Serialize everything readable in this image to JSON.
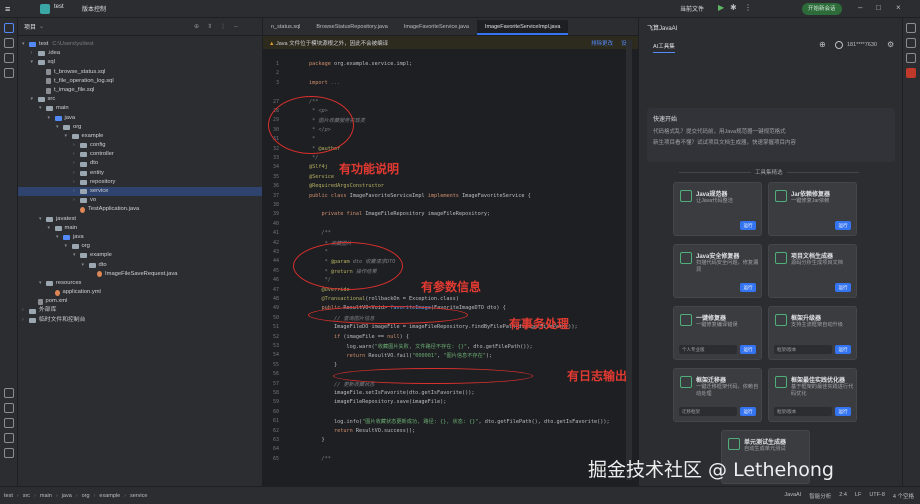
{
  "titlebar": {
    "project_name": "test",
    "branch": "版本控制",
    "run_config": "当前文件",
    "run_button": "开始新会话"
  },
  "project": {
    "title": "项目",
    "rows": [
      {
        "d": 0,
        "t": "test",
        "x": "C:\\Users\\yu\\test",
        "k": "fb",
        "a": "▾"
      },
      {
        "d": 1,
        "t": ".idea",
        "k": "f",
        "a": "›"
      },
      {
        "d": 1,
        "t": "sql",
        "k": "f",
        "a": "▾"
      },
      {
        "d": 2,
        "t": "t_browse_status.sql",
        "k": "file"
      },
      {
        "d": 2,
        "t": "t_file_operation_log.sql",
        "k": "file"
      },
      {
        "d": 2,
        "t": "t_image_file.sql",
        "k": "file"
      },
      {
        "d": 1,
        "t": "src",
        "k": "f",
        "a": "▾"
      },
      {
        "d": 2,
        "t": "main",
        "k": "f",
        "a": "▾"
      },
      {
        "d": 3,
        "t": "java",
        "k": "fb",
        "a": "▾"
      },
      {
        "d": 4,
        "t": "org",
        "k": "f",
        "a": "▾"
      },
      {
        "d": 5,
        "t": "example",
        "k": "f",
        "a": "▾"
      },
      {
        "d": 6,
        "t": "config",
        "k": "f",
        "a": "›"
      },
      {
        "d": 6,
        "t": "controller",
        "k": "f",
        "a": "›"
      },
      {
        "d": 6,
        "t": "dto",
        "k": "f",
        "a": "›"
      },
      {
        "d": 6,
        "t": "entity",
        "k": "f",
        "a": "›"
      },
      {
        "d": 6,
        "t": "repository",
        "k": "f",
        "a": "›"
      },
      {
        "d": 6,
        "t": "service",
        "k": "f",
        "a": "›",
        "sel": true
      },
      {
        "d": 6,
        "t": "vo",
        "k": "f",
        "a": "›"
      },
      {
        "d": 6,
        "t": "TestApplication.java",
        "k": "j"
      },
      {
        "d": 2,
        "t": "javatest",
        "k": "f",
        "a": "▾"
      },
      {
        "d": 3,
        "t": "main",
        "k": "f",
        "a": "▾"
      },
      {
        "d": 4,
        "t": "java",
        "k": "fb",
        "a": "▾"
      },
      {
        "d": 5,
        "t": "org",
        "k": "f",
        "a": "▾"
      },
      {
        "d": 6,
        "t": "example",
        "k": "f",
        "a": "▾"
      },
      {
        "d": 7,
        "t": "dto",
        "k": "f",
        "a": "▾"
      },
      {
        "d": 8,
        "t": "ImageFileSaveRequest.java",
        "k": "j"
      },
      {
        "d": 2,
        "t": "resources",
        "k": "f",
        "a": "▾"
      },
      {
        "d": 3,
        "t": "application.yml",
        "k": "j"
      },
      {
        "d": 1,
        "t": "pom.xml",
        "k": "file"
      },
      {
        "d": 0,
        "t": "外部库",
        "k": "f",
        "a": "›"
      },
      {
        "d": 0,
        "t": "临时文件和控制台",
        "k": "f",
        "a": "›"
      }
    ]
  },
  "editor": {
    "tabs": [
      "n_status.sql",
      "BrowseStatusRepository.java",
      "ImageFavoriteService.java",
      "ImageFavoriteServiceImpl.java"
    ],
    "active_tab": 3,
    "banner": "Java 文件位于模块源根之外，因此不会被编译",
    "banner_action": "排除更改",
    "banner_action2": "设置",
    "lines": [
      {
        "n": "1",
        "c": [
          [
            "kw",
            "package "
          ],
          [
            "ty",
            "org.example.service.impl;"
          ]
        ]
      },
      {
        "n": "2",
        "c": []
      },
      {
        "n": "3",
        "c": [
          [
            "kw",
            "import "
          ],
          [
            "cm",
            "..."
          ]
        ]
      },
      {
        "n": "",
        "c": []
      },
      {
        "n": "27",
        "c": [
          [
            "cm",
            "/**"
          ]
        ]
      },
      {
        "n": "28",
        "c": [
          [
            "cm",
            " * <p>"
          ]
        ]
      },
      {
        "n": "29",
        "c": [
          [
            "cm",
            " * 图片收藏服务实现类"
          ]
        ]
      },
      {
        "n": "30",
        "c": [
          [
            "cm",
            " * </p>"
          ]
        ]
      },
      {
        "n": "31",
        "c": [
          [
            "cm",
            " *"
          ]
        ]
      },
      {
        "n": "32",
        "c": [
          [
            "cm",
            " * "
          ],
          [
            "an",
            "@author"
          ]
        ]
      },
      {
        "n": "33",
        "c": [
          [
            "cm",
            " */"
          ]
        ]
      },
      {
        "n": "34",
        "c": [
          [
            "an",
            "@Slf4j"
          ]
        ]
      },
      {
        "n": "35",
        "c": [
          [
            "an",
            "@Service"
          ]
        ]
      },
      {
        "n": "36",
        "c": [
          [
            "an",
            "@RequiredArgsConstructor"
          ]
        ]
      },
      {
        "n": "37",
        "c": [
          [
            "kw",
            "public class "
          ],
          [
            "ty",
            "ImageFavoriteServiceImpl "
          ],
          [
            "kw",
            "implements "
          ],
          [
            "ty",
            "ImageFavoriteService {"
          ]
        ]
      },
      {
        "n": "38",
        "c": []
      },
      {
        "n": "39",
        "c": [
          [
            "kw",
            "    private final "
          ],
          [
            "ty",
            "ImageFileRepository imageFileRepository;"
          ]
        ]
      },
      {
        "n": "40",
        "c": []
      },
      {
        "n": "41",
        "c": [
          [
            "cm",
            "    /**"
          ]
        ]
      },
      {
        "n": "42",
        "c": [
          [
            "cm",
            "     * 收藏图片"
          ]
        ]
      },
      {
        "n": "43",
        "c": [
          [
            "cm",
            "     *"
          ]
        ]
      },
      {
        "n": "44",
        "c": [
          [
            "cm",
            "     * "
          ],
          [
            "an",
            "@param "
          ],
          [
            "cm",
            "dto 收藏请求DTO"
          ]
        ]
      },
      {
        "n": "45",
        "c": [
          [
            "cm",
            "     * "
          ],
          [
            "an",
            "@return "
          ],
          [
            "cm",
            "操作结果"
          ]
        ]
      },
      {
        "n": "46",
        "c": [
          [
            "cm",
            "     */"
          ]
        ]
      },
      {
        "n": "47",
        "c": [
          [
            "an",
            "    @Override"
          ]
        ]
      },
      {
        "n": "48",
        "c": [
          [
            "an",
            "    @Transactional"
          ],
          [
            "ty",
            "(rollbackOn = Exception.class)"
          ]
        ]
      },
      {
        "n": "49",
        "c": [
          [
            "kw",
            "    public "
          ],
          [
            "ty",
            "ResultVO<Void> "
          ],
          [
            "fn",
            "favoriteImage"
          ],
          [
            "ty",
            "(FavoriteImageDTO dto) {"
          ]
        ]
      },
      {
        "n": "50",
        "c": [
          [
            "cm",
            "        // 查询图片信息"
          ]
        ]
      },
      {
        "n": "51",
        "c": [
          [
            "ty",
            "        ImageFileDO imageFile = imageFileRepository.findByFilePath(dto.getFilePath());"
          ]
        ]
      },
      {
        "n": "52",
        "c": [
          [
            "kw",
            "        if "
          ],
          [
            "ty",
            "(imageFile == "
          ],
          [
            "kw",
            "null"
          ],
          [
            "ty",
            ") {"
          ]
        ]
      },
      {
        "n": "53",
        "c": [
          [
            "ty",
            "            log.warn("
          ],
          [
            "st",
            "\"收藏图片失败, 文件路径不存在: {}\""
          ],
          [
            "ty",
            ", dto.getFilePath());"
          ]
        ]
      },
      {
        "n": "54",
        "c": [
          [
            "kw",
            "            return "
          ],
          [
            "ty",
            "ResultVO.fail("
          ],
          [
            "st",
            "\"000001\""
          ],
          [
            "ty",
            ", "
          ],
          [
            "st",
            "\"图片信息不存在\""
          ],
          [
            "ty",
            ");"
          ]
        ]
      },
      {
        "n": "55",
        "c": [
          [
            "ty",
            "        }"
          ]
        ]
      },
      {
        "n": "56",
        "c": []
      },
      {
        "n": "57",
        "c": [
          [
            "cm",
            "        // 更新收藏状态"
          ]
        ]
      },
      {
        "n": "58",
        "c": [
          [
            "ty",
            "        imageFile.setIsFavorite(dto.getIsFavorite());"
          ]
        ]
      },
      {
        "n": "59",
        "c": [
          [
            "ty",
            "        imageFileRepository.save(imageFile);"
          ]
        ]
      },
      {
        "n": "60",
        "c": []
      },
      {
        "n": "61",
        "c": [
          [
            "ty",
            "        log.info("
          ],
          [
            "st",
            "\"图片收藏状态更新成功, 路径: {}, 状态: {}\""
          ],
          [
            "ty",
            ", dto.getFilePath(), dto.getIsFavorite());"
          ]
        ]
      },
      {
        "n": "62",
        "c": [
          [
            "kw",
            "        return "
          ],
          [
            "ty",
            "ResultVO.success();"
          ]
        ]
      },
      {
        "n": "63",
        "c": [
          [
            "ty",
            "    }"
          ]
        ]
      },
      {
        "n": "64",
        "c": []
      },
      {
        "n": "65",
        "c": [
          [
            "cm",
            "    /**"
          ]
        ]
      }
    ],
    "annotations": {
      "a1": "有功能说明",
      "a2": "有参数信息",
      "a3": "有事务处理",
      "a4": "有日志输出"
    }
  },
  "ai": {
    "title": "飞算JavaAI",
    "tab": "AI工具集",
    "user": "181****7630",
    "quick_title": "快速开始",
    "quick_line1": "代码格式乱？提交代码前，用Java规范器一键规范格式",
    "quick_line2": "新生项目看不懂？试试项目文档生成器，快速掌握项目内容",
    "section_label": "工具集精选",
    "cards": [
      {
        "t": "Java规范器",
        "d": "让Java代码整洁",
        "b": "运行"
      },
      {
        "t": "Jar依赖修复器",
        "d": "一键修复Jar依赖",
        "b": "运行"
      },
      {
        "t": "Java安全修复器",
        "d": "扫描代码安全问题，修复漏洞",
        "b": "运行"
      },
      {
        "t": "项目文档生成器",
        "d": "源码分析生成项目文档",
        "b": "运行"
      },
      {
        "t": "一键修复器",
        "d": "一键修复编译错误",
        "b": "运行",
        "sel": "个人专业版"
      },
      {
        "t": "框架升级器",
        "d": "支持主流框架自动升级",
        "b": "运行",
        "sel": "框架/版本"
      },
      {
        "t": "框架迁移器",
        "d": "一键迁移框架代码，依赖自动处理",
        "b": "运行",
        "sel": "迁移框架"
      },
      {
        "t": "框架最佳实践优化器",
        "d": "基于框架的最佳实践进行代码优化",
        "b": "运行",
        "sel": "框架/版本"
      },
      {
        "t": "单元测试生成器",
        "d": "自动生成单元测试",
        "b": "运行"
      }
    ]
  },
  "status": {
    "crumbs": [
      "test",
      "src",
      "main",
      "java",
      "org",
      "example",
      "service"
    ],
    "right": [
      "JavaAI",
      "智能分析",
      "2:4",
      "LF",
      "UTF-8",
      "4 个空格"
    ]
  },
  "watermark": "掘金技术社区 @ Lethehong"
}
